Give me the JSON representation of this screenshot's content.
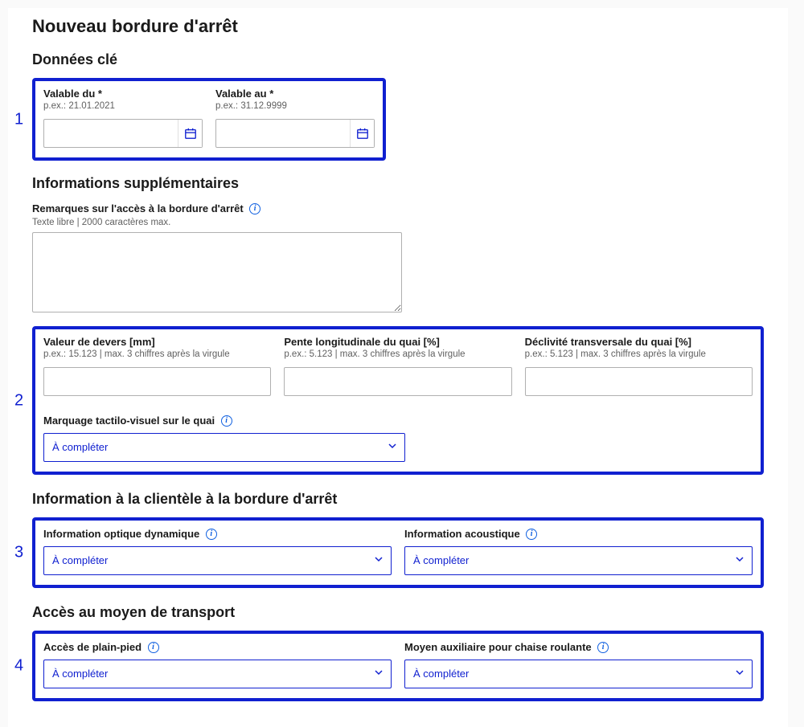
{
  "title": "Nouveau bordure d'arrêt",
  "box_numbers": {
    "b1": "1",
    "b2": "2",
    "b3": "3",
    "b4": "4"
  },
  "sections": {
    "key_data": {
      "heading": "Données clé",
      "valid_from": {
        "label": "Valable du *",
        "hint": "p.ex.: 21.01.2021",
        "value": ""
      },
      "valid_to": {
        "label": "Valable au *",
        "hint": "p.ex.: 31.12.9999",
        "value": ""
      }
    },
    "extra": {
      "heading": "Informations supplémentaires",
      "remarks": {
        "label": "Remarques sur l'accès à la bordure d'arrêt",
        "hint": "Texte libre | 2000 caractères max.",
        "value": ""
      },
      "superelevation": {
        "label": "Valeur de devers [mm]",
        "hint": "p.ex.: 15.123 | max. 3 chiffres après la virgule",
        "value": ""
      },
      "long_slope": {
        "label": "Pente longitudinale du quai [%]",
        "hint": "p.ex.: 5.123 | max. 3 chiffres après la virgule",
        "value": ""
      },
      "cross_slope": {
        "label": "Déclivité transversale du quai [%]",
        "hint": "p.ex.: 5.123 | max. 3 chiffres après la virgule",
        "value": ""
      },
      "tactile": {
        "label": "Marquage tactilo-visuel sur le quai",
        "value": "À compléter"
      }
    },
    "customer_info": {
      "heading": "Information à la clientèle à la bordure d'arrêt",
      "optical": {
        "label": "Information optique dynamique",
        "value": "À compléter"
      },
      "acoustic": {
        "label": "Information acoustique",
        "value": "À compléter"
      }
    },
    "transport_access": {
      "heading": "Accès au moyen de transport",
      "level_access": {
        "label": "Accès de plain-pied",
        "value": "À compléter"
      },
      "wheelchair_aid": {
        "label": "Moyen auxiliaire pour chaise roulante",
        "value": "À compléter"
      }
    }
  }
}
